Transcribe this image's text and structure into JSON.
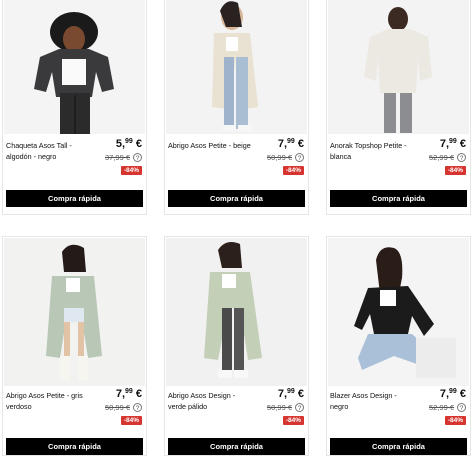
{
  "colors": {
    "sale_badge": "#d6352f",
    "button_bg": "#000000",
    "button_text": "#ffffff"
  },
  "products": [
    {
      "name": "Chaqueta Asos Tall - algodón - negro",
      "price_int": "5",
      "price_dec": "99",
      "price_sym": "€",
      "old_price": "37,99 €",
      "discount": "-84%",
      "button": "Compra rápida",
      "info": "?"
    },
    {
      "name": "Abrigo Asos Petite - beige",
      "price_int": "7",
      "price_dec": "99",
      "price_sym": "€",
      "old_price": "50,99 €",
      "discount": "-84%",
      "button": "Compra rápida",
      "info": "?"
    },
    {
      "name": "Anorak Topshop Petite - blanca",
      "price_int": "7",
      "price_dec": "99",
      "price_sym": "€",
      "old_price": "52,99 €",
      "discount": "-84%",
      "button": "Compra rápida",
      "info": "?"
    },
    {
      "name": "Abrigo Asos Petite - gris verdoso",
      "price_int": "7",
      "price_dec": "99",
      "price_sym": "€",
      "old_price": "50,99 €",
      "discount": "-84%",
      "button": "Compra rápida",
      "info": "?"
    },
    {
      "name": "Abrigo Asos Design - verde pálido",
      "price_int": "7",
      "price_dec": "99",
      "price_sym": "€",
      "old_price": "50,99 €",
      "discount": "-84%",
      "button": "Compra rápida",
      "info": "?"
    },
    {
      "name": "Blazer Asos Design - negro",
      "price_int": "7",
      "price_dec": "99",
      "price_sym": "€",
      "old_price": "52,99 €",
      "discount": "-84%",
      "button": "Compra rápida",
      "info": "?"
    }
  ]
}
